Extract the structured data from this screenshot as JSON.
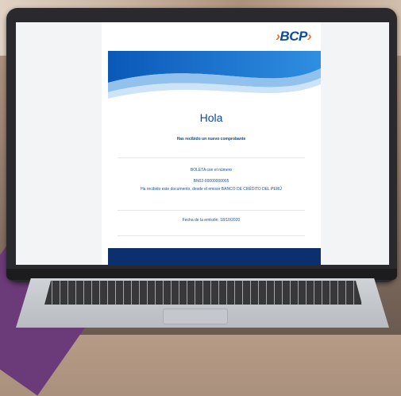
{
  "email": {
    "brand": {
      "chevron_left": "›",
      "name": "BCP",
      "chevron_right": "›"
    },
    "greeting": "Hola",
    "subtitle": "Has recibido un nuevo comprobante",
    "doc_line": "BOLETA con el número",
    "doc_number": "BN02-00000000005",
    "sender_line": "Ha recibido este documento, desde el emisor BANCO DE CRÉDITO DEL PERÚ",
    "date_line": "Fecha de la emisión: 18/10/2020"
  },
  "colors": {
    "brand_blue": "#0a4aa0",
    "brand_orange": "#f37021",
    "footer_navy": "#0c2f6e"
  }
}
